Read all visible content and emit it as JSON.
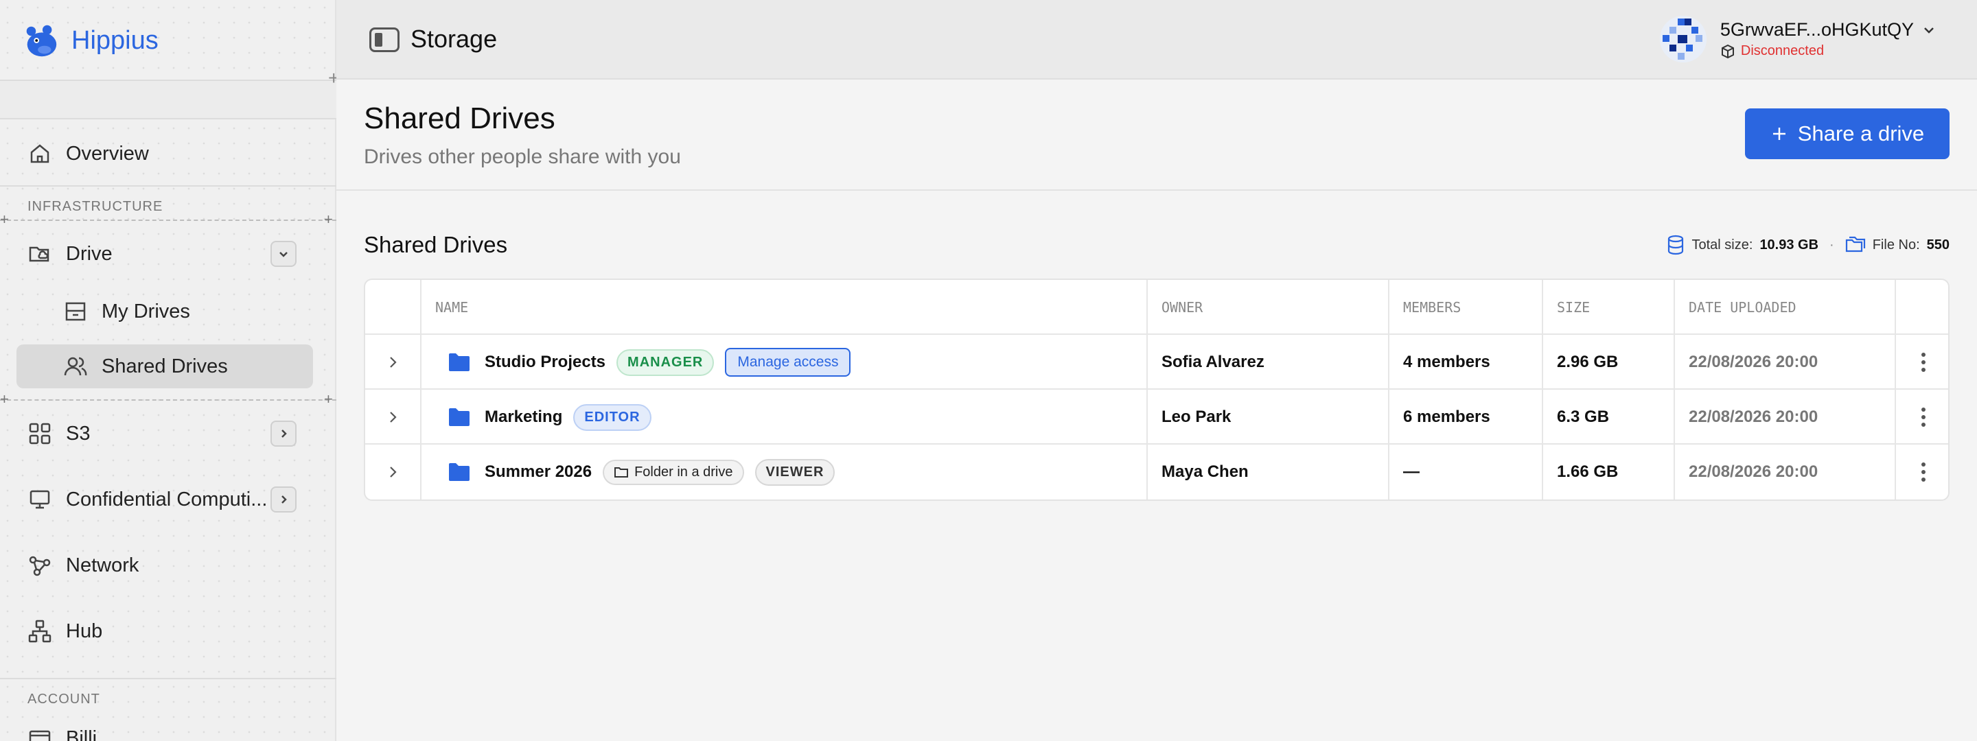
{
  "app": {
    "brand_name": "Hippius",
    "page_header": "Storage"
  },
  "sidebar": {
    "overview": "Overview",
    "section_infrastructure": "INFRASTRUCTURE",
    "drive": "Drive",
    "my_drives": "My Drives",
    "shared_drives": "Shared Drives",
    "s3": "S3",
    "confidential": "Confidential Computi...",
    "network": "Network",
    "hub": "Hub",
    "section_account": "ACCOUNT",
    "billing_partial": "Billi..."
  },
  "account": {
    "name": "5GrwvaEF...oHGKutQY",
    "status": "Disconnected"
  },
  "page": {
    "title": "Shared Drives",
    "subtitle": "Drives other people share with you",
    "share_button": "Share a drive",
    "section_title": "Shared Drives",
    "total_size_label": "Total size:",
    "total_size_value": "10.93 GB",
    "separator": "·",
    "file_no_label": "File No:",
    "file_no_value": "550"
  },
  "table": {
    "headers": {
      "name": "NAME",
      "owner": "OWNER",
      "members": "MEMBERS",
      "size": "SIZE",
      "date": "DATE UPLOADED"
    },
    "rows": [
      {
        "name": "Studio Projects",
        "role": "MANAGER",
        "manage": "Manage access",
        "owner": "Sofia Alvarez",
        "members": "4 members",
        "size": "2.96 GB",
        "date": "22/08/2026 20:00"
      },
      {
        "name": "Marketing",
        "role": "EDITOR",
        "owner": "Leo Park",
        "members": "6 members",
        "size": "6.3 GB",
        "date": "22/08/2026 20:00"
      },
      {
        "name": "Summer 2026",
        "tag": "Folder in a drive",
        "role": "VIEWER",
        "owner": "Maya Chen",
        "members": "—",
        "size": "1.66 GB",
        "date": "22/08/2026 20:00"
      }
    ]
  },
  "colors": {
    "accent": "#2b66e0",
    "danger": "#e03131",
    "manager": "#1a8f4a"
  }
}
